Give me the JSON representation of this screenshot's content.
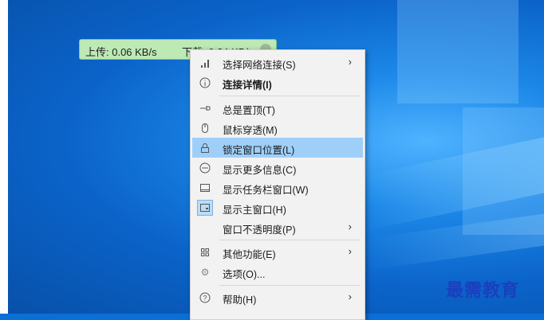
{
  "speed_bar": {
    "upload": "上传: 0.06 KB/s",
    "download": "下载: 0.34 KB/s"
  },
  "menu": {
    "items": [
      {
        "label": "选择网络连接(S)",
        "icon": "signal-bars-icon",
        "submenu": true,
        "bold": false
      },
      {
        "label": "连接详情(I)",
        "icon": "info-icon",
        "submenu": false,
        "bold": true
      },
      {
        "label": "总是置顶(T)",
        "icon": "pin-icon",
        "submenu": false,
        "bold": false
      },
      {
        "label": "鼠标穿透(M)",
        "icon": "mouse-icon",
        "submenu": false,
        "bold": false
      },
      {
        "label": "锁定窗口位置(L)",
        "icon": "lock-icon",
        "submenu": false,
        "bold": false,
        "highlighted": true
      },
      {
        "label": "显示更多信息(C)",
        "icon": "more-icon",
        "submenu": false,
        "bold": false
      },
      {
        "label": "显示任务栏窗口(W)",
        "icon": "taskbar-icon",
        "submenu": false,
        "bold": false
      },
      {
        "label": "显示主窗口(H)",
        "icon": "window-icon",
        "submenu": false,
        "bold": false,
        "checked": true
      },
      {
        "label": "窗口不透明度(P)",
        "icon": "",
        "submenu": true,
        "bold": false
      },
      {
        "label": "其他功能(E)",
        "icon": "grid-icon",
        "submenu": true,
        "bold": false
      },
      {
        "label": "选项(O)...",
        "icon": "gear-icon",
        "submenu": false,
        "bold": false
      },
      {
        "label": "帮助(H)",
        "icon": "help-icon",
        "submenu": true,
        "bold": false
      }
    ]
  },
  "watermark": "最需教育",
  "colors": {
    "highlight": "#9ecff9",
    "speed_bar_bg": "#bde9b4",
    "desktop": "#0b63c9"
  }
}
